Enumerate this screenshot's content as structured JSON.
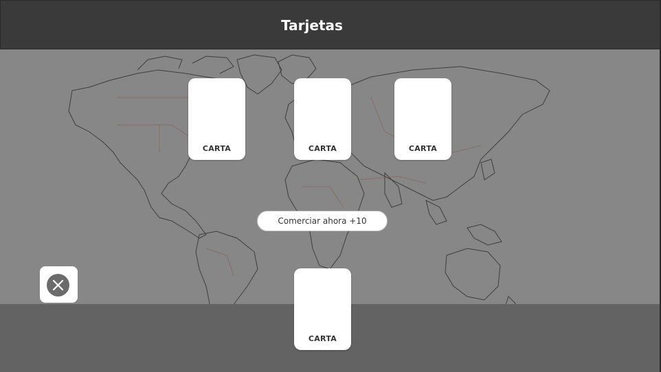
{
  "header": {
    "title": "Tarjetas"
  },
  "cards": {
    "top": [
      {
        "label": "CARTA"
      },
      {
        "label": "CARTA"
      },
      {
        "label": "CARTA"
      }
    ],
    "bottom": {
      "label": "CARTA"
    }
  },
  "trade_button": {
    "label": "Comerciar ahora +10"
  },
  "close_button": {
    "icon": "close-icon"
  },
  "colors": {
    "header_bg": "#3a3a3a",
    "overlay": "#878787",
    "bottom_band": "#636363",
    "card_bg": "#ffffff",
    "close_circle": "#6b6b6b"
  }
}
